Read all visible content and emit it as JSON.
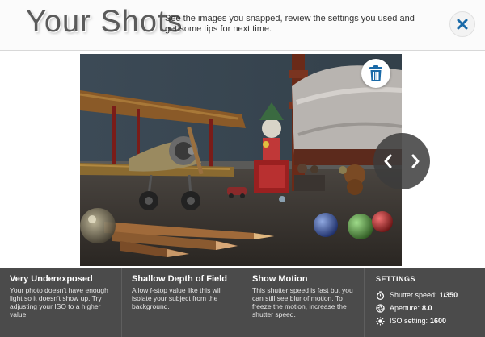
{
  "header": {
    "title": "Your Shots",
    "subtitle": "See the images you snapped, review the settings you used and get some tips for next time."
  },
  "icons": {
    "close": "close-icon",
    "trash": "trash-icon",
    "prev": "chevron-left-icon",
    "next": "chevron-right-icon",
    "shutter": "stopwatch-icon",
    "aperture": "aperture-icon",
    "iso": "sun-icon"
  },
  "colors": {
    "accent": "#1a6aa8",
    "footer_bg": "#4b4b4b"
  },
  "tips": [
    {
      "title": "Very Underexposed",
      "text": "Your photo doesn't have enough light so it doesn't show up. Try adjusting your ISO to a higher value."
    },
    {
      "title": "Shallow Depth of Field",
      "text": "A low f-stop value like this will isolate your subject from the background."
    },
    {
      "title": "Show Motion",
      "text": "This shutter speed is fast but you can still see blur of motion. To freeze the motion, increase the shutter speed."
    }
  ],
  "settings": {
    "title": "SETTINGS",
    "shutter_label": "Shutter speed:",
    "shutter_value": "1/350",
    "aperture_label": "Aperture:",
    "aperture_value": "8.0",
    "iso_label": "ISO setting:",
    "iso_value": "1600"
  }
}
